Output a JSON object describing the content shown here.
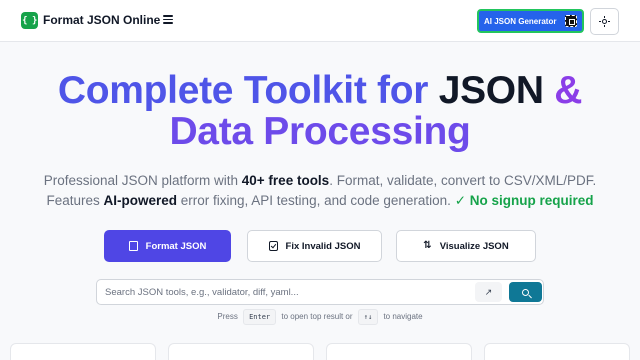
{
  "header": {
    "logo_glyph": "{ }",
    "brand": "Format JSON Online",
    "ai_button": "AI JSON Generator"
  },
  "hero": {
    "line1_a": "Complete Toolkit for ",
    "line1_b": "JSON",
    "line1_c": " &",
    "line2": "Data Processing"
  },
  "subtitle": {
    "p1": "Professional JSON platform with ",
    "p1_bold": "40+ free tools",
    "p2": ". Format, validate, convert to CSV/XML/PDF.",
    "p3": "Features ",
    "p3_bold": "AI-powered",
    "p4": " error fixing, API testing, and code generation. ",
    "p4_green": "✓ No signup required"
  },
  "cta": {
    "primary": "Format JSON",
    "fix": "Fix Invalid JSON",
    "visualize": "Visualize JSON"
  },
  "search": {
    "placeholder": "Search JSON tools, e.g., validator, diff, yaml...",
    "value": "",
    "arrow_glyph": "↗"
  },
  "hint": {
    "press": "Press",
    "key1": "Enter",
    "mid": "to open top result or",
    "key2": "↑↓",
    "end": "to navigate"
  },
  "colors": {
    "accent": "#4f46e5",
    "brand_green": "#16a34a",
    "ai_button_bg": "#2563eb",
    "search_button_bg": "#0f7896"
  }
}
